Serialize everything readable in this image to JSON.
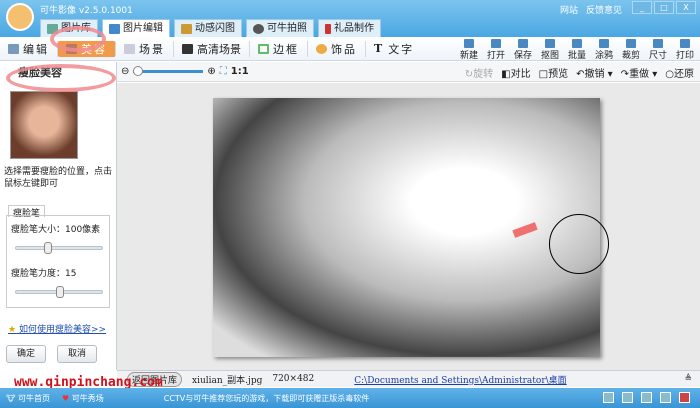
{
  "app": {
    "title": "可牛影像 v2.5.0.1001",
    "links": [
      "网站",
      "反馈意见"
    ]
  },
  "tabs": [
    {
      "label": "图片库"
    },
    {
      "label": "图片编辑"
    },
    {
      "label": "动感闪图"
    },
    {
      "label": "可牛拍照"
    },
    {
      "label": "礼品制作"
    }
  ],
  "tools": [
    {
      "label": "编辑"
    },
    {
      "label": "美容"
    },
    {
      "label": "场景"
    },
    {
      "label": "高清场景"
    },
    {
      "label": "边框"
    },
    {
      "label": "饰品"
    },
    {
      "label": "文字"
    }
  ],
  "right_tools": [
    "新建",
    "打开",
    "保存",
    "抠图",
    "批量",
    "涂鸦",
    "裁剪",
    "尺寸",
    "打印"
  ],
  "zoom": {
    "ratio_label": "1:1",
    "level": 0
  },
  "ops": {
    "rotate": "旋转",
    "compare": "对比",
    "preview": "预览",
    "undo": "撤销",
    "redo": "重做",
    "restore": "还原"
  },
  "panel": {
    "title": "瘦脸美容",
    "desc": "选择需要瘦脸的位置，点击鼠标左键即可",
    "pen_tab": "瘦脸笔",
    "size_label": "瘦脸笔大小：100像素",
    "size_value": 0.35,
    "strength_label": "瘦脸笔力度：15",
    "strength_value": 0.5,
    "help": "如何使用瘦脸美容>>",
    "ok": "确定",
    "cancel": "取消"
  },
  "info": {
    "back": "返回图片库",
    "filename": "xiulian_副本.jpg",
    "dimensions": "720×482",
    "path": "C:\\Documents and Settings\\Administrator\\桌面"
  },
  "watermark": "www.qinpinchang.com",
  "status": {
    "home": "可牛首页",
    "show": "可牛秀场",
    "ad": "CCTV与可牛推荐您玩的游戏，下载即可获赠正版杀毒软件"
  }
}
